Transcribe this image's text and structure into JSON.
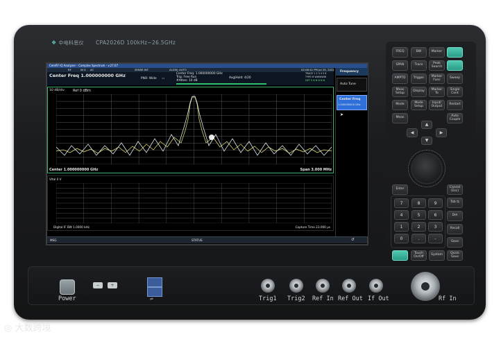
{
  "device": {
    "brand": "中电科思仪",
    "model": "CPA2026D  100kHz~26.5GHz"
  },
  "screen": {
    "titlebar": "CeleRF IQ Analyzer - Complex Spectrum - v.27.07",
    "topbar": {
      "items": [
        "RF",
        "IN 0",
        "AC"
      ],
      "sense": "SENSE:INT",
      "align": "ALIGN: AUTO",
      "datetime": "02:06:41 PM Jul 25, 2022"
    },
    "center_title": "Center Freq 1.000000000 GHz",
    "pno": "PNO: Wide",
    "info_center": "Center Freq: 1.000000000 GHz",
    "info_trig": "Trig: Free Run",
    "info_atten": "#Atten: 10 dB",
    "avg_hold": "Avg|Hold: 4/20",
    "trace_lines": [
      "TRACE 1 2 3 4 5 6",
      "TYPE M WWWWW",
      "DET S N N N N N"
    ],
    "scale": "10 dB/div",
    "ref": "Ref  0 dBm",
    "lower_left": "Center 1.000000000 GHz",
    "lower_right": "Span 3.000 MHz",
    "iq_scale": "Vital  0 V",
    "bottom_left": "Digital IF BW  1.0000 kHz",
    "bottom_right": "Capture Time 23.000 μs",
    "status_left": "MSG",
    "status_mid": "STATUS",
    "softkeys": {
      "header": "Frequency",
      "auto_tune": "Auto Tune",
      "center_freq_label": "Center Freq",
      "center_freq_value": "1.000000000 GHz"
    }
  },
  "hard_keys": [
    [
      "FREQ",
      "BW",
      "Marker",
      ""
    ],
    [
      "SPAN",
      "Trace",
      "Peak Search",
      ""
    ],
    [
      "AMPTD",
      "Trigger",
      "Marker Func",
      "Sweep"
    ],
    [
      "Meas Setup",
      "Display",
      "Marker To",
      "Single Cont"
    ],
    [
      "Mode",
      "Mode Setup",
      "Input/ Output",
      "Restart"
    ],
    [
      "Meas",
      "",
      "",
      "Auto Couple"
    ]
  ],
  "side_keys": {
    "enter": "Enter",
    "cancel": "Cancel (Esc)",
    "tab": "Tab ⇆",
    "del": "Del",
    "recall": "Recall",
    "save": "Save",
    "quick_save": "Quick Save",
    "system": "System",
    "touch": "Touch On/Off"
  },
  "numpad": [
    "7",
    "8",
    "9",
    "4",
    "5",
    "6",
    "1",
    "2",
    "3",
    "0",
    ".",
    "-"
  ],
  "ports": {
    "power": "Power",
    "trig1": "Trig1",
    "trig2": "Trig2",
    "rf_in": "Ref In",
    "ref_out": "Ref Out",
    "if_out": "If Out",
    "rf_in_main": "Rf In"
  },
  "watermark": "大数跨境"
}
